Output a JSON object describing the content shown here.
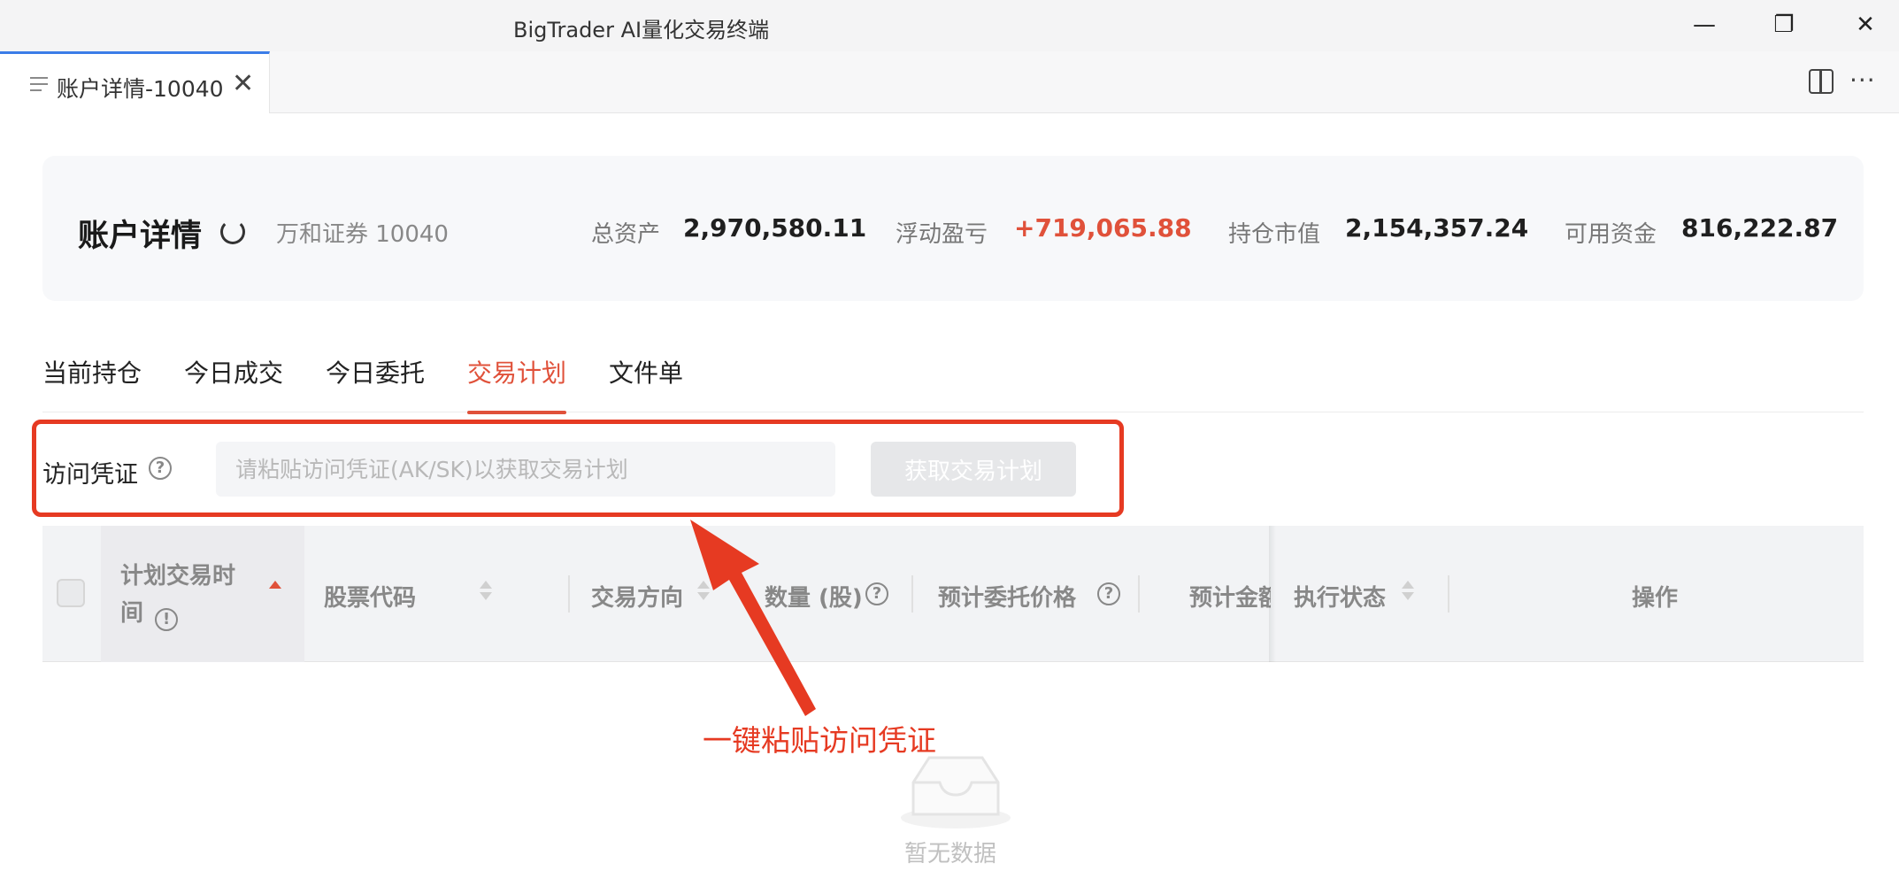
{
  "app": {
    "title": "BigTrader AI量化交易终端"
  },
  "window_controls": {
    "minimize": "—",
    "restore": "❐",
    "close": "✕"
  },
  "doc_tab": {
    "label": "账户详情-10040",
    "close": "✕"
  },
  "toolbar": {
    "more": "···"
  },
  "summary": {
    "title": "账户详情",
    "broker": "万和证券 10040",
    "stats": [
      {
        "label": "总资产",
        "value": "2,970,580.11"
      },
      {
        "label": "浮动盈亏",
        "value": "+719,065.88"
      },
      {
        "label": "持仓市值",
        "value": "2,154,357.24"
      },
      {
        "label": "可用资金",
        "value": "816,222.87"
      }
    ]
  },
  "tabs": [
    {
      "label": "当前持仓",
      "active": false
    },
    {
      "label": "今日成交",
      "active": false
    },
    {
      "label": "今日委托",
      "active": false
    },
    {
      "label": "交易计划",
      "active": true
    },
    {
      "label": "文件单",
      "active": false
    }
  ],
  "credential": {
    "label": "访问凭证",
    "help": "?",
    "value": "",
    "placeholder": "请粘贴访问凭证(AK/SK)以获取交易计划",
    "button": "获取交易计划"
  },
  "table": {
    "columns": [
      {
        "label": "计划交易时间",
        "sort": "asc"
      },
      {
        "label": "股票代码",
        "sort": "none"
      },
      {
        "label": "交易方向",
        "sort": "none"
      },
      {
        "label": "数量 (股)",
        "help": "?"
      },
      {
        "label": "预计委托价格",
        "help": "?"
      },
      {
        "label": "预计金额"
      },
      {
        "label": "执行状态",
        "sort": "none"
      },
      {
        "label": "操作"
      }
    ],
    "time_col_line1": "计划交易时",
    "time_col_line2": "间",
    "time_col_info": "!",
    "amount_visible": "预计金额",
    "rows": [],
    "empty_text": "暂无数据"
  },
  "annotation": {
    "text": "一键粘贴访问凭证"
  },
  "colors": {
    "accent": "#e0513a",
    "annotation": "#e63a22",
    "tab_active_border": "#3b7de8"
  }
}
